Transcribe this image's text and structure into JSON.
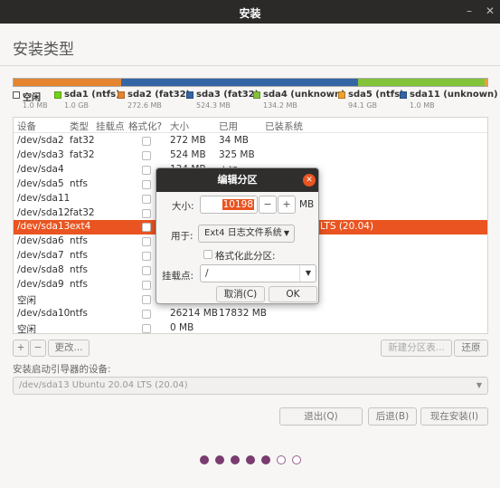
{
  "window": {
    "title": "安装",
    "minimize_glyph": "–",
    "close_glyph": "✕"
  },
  "page_heading": "安装类型",
  "partition_bar": {
    "segments": [
      {
        "name": "空闲",
        "fraction": 0.0003,
        "color": "#f0f0f0"
      },
      {
        "name": "sda1",
        "fraction": 0.0003,
        "color": "#73d216"
      },
      {
        "name": "sda2",
        "fraction": 0.227,
        "color": "#e5852f"
      },
      {
        "name": "sda3",
        "fraction": 0.499,
        "color": "#3465a4"
      },
      {
        "name": "sda4",
        "fraction": 0.267,
        "color": "#82c33a"
      },
      {
        "name": "sda5",
        "fraction": 0.006,
        "color": "#f0a030"
      },
      {
        "name": "sda11",
        "fraction": 0.0003,
        "color": "#3465a4"
      }
    ]
  },
  "legend": [
    {
      "name": "空闲",
      "size": "1.0 MB",
      "color": "#ffffff",
      "icon": "empty-square-icon"
    },
    {
      "name": "sda1 (ntfs)",
      "size": "1.0 GB",
      "color": "#73d216"
    },
    {
      "name": "sda2 (fat32)",
      "size": "272.6 MB",
      "color": "#e5852f"
    },
    {
      "name": "sda3 (fat32)",
      "size": "524.3 MB",
      "color": "#3465a4"
    },
    {
      "name": "sda4 (unknown)",
      "size": "134.2 MB",
      "color": "#82c33a"
    },
    {
      "name": "sda5 (ntfs)",
      "size": "94.1 GB",
      "color": "#f0a030"
    },
    {
      "name": "sda11 (unknown)",
      "size": "1.0 MB",
      "color": "#3465a4"
    }
  ],
  "table": {
    "headers": [
      "设备",
      "类型",
      "挂载点",
      "格式化?",
      "大小",
      "已用",
      "已装系统"
    ],
    "rows": [
      {
        "device": "/dev/sda2",
        "type": "fat32",
        "mount": "",
        "size": "272 MB",
        "used": "34 MB",
        "system": ""
      },
      {
        "device": "/dev/sda3",
        "type": "fat32",
        "mount": "",
        "size": "524 MB",
        "used": "325 MB",
        "system": ""
      },
      {
        "device": "/dev/sda4",
        "type": "",
        "mount": "",
        "size": "134 MB",
        "used": "未知",
        "system": ""
      },
      {
        "device": "/dev/sda5",
        "type": "ntfs",
        "mount": "",
        "size": "",
        "used": "",
        "system": ""
      },
      {
        "device": "/dev/sda11",
        "type": "",
        "mount": "",
        "size": "",
        "used": "",
        "system": ""
      },
      {
        "device": "/dev/sda12",
        "type": "fat32",
        "mount": "",
        "size": "",
        "used": "",
        "system": ""
      },
      {
        "device": "/dev/sda13",
        "type": "ext4",
        "mount": "",
        "size": "",
        "used": "",
        "system": "LTS (20.04)",
        "selected": true
      },
      {
        "device": "/dev/sda6",
        "type": "ntfs",
        "mount": "",
        "size": "",
        "used": "",
        "system": ""
      },
      {
        "device": "/dev/sda7",
        "type": "ntfs",
        "mount": "",
        "size": "",
        "used": "",
        "system": ""
      },
      {
        "device": "/dev/sda8",
        "type": "ntfs",
        "mount": "",
        "size": "",
        "used": "",
        "system": ""
      },
      {
        "device": "/dev/sda9",
        "type": "ntfs",
        "mount": "",
        "size": "",
        "used": "",
        "system": ""
      },
      {
        "device": "空闲",
        "type": "",
        "mount": "",
        "size": "",
        "used": "",
        "system": ""
      },
      {
        "device": "/dev/sda10",
        "type": "ntfs",
        "mount": "",
        "size": "26214 MB",
        "used": "17832 MB",
        "system": ""
      },
      {
        "device": "空闲",
        "type": "",
        "mount": "",
        "size": "0 MB",
        "used": "",
        "system": ""
      }
    ]
  },
  "table_tools": {
    "add": "+",
    "remove": "−",
    "change": "更改...",
    "new_table": "新建分区表...",
    "revert": "还原"
  },
  "boot_loader": {
    "label": "安装启动引导器的设备:",
    "value": "/dev/sda13 Ubuntu 20.04 LTS (20.04)",
    "arrow": "▼"
  },
  "actions": {
    "quit": "退出(Q)",
    "back": "后退(B)",
    "install": "现在安装(I)"
  },
  "progress": {
    "total_steps": 7,
    "current_step": 5
  },
  "dialog": {
    "title": "编辑分区",
    "close_glyph": "✕",
    "size_label": "大小:",
    "size_value": "10198",
    "minus": "−",
    "plus": "+",
    "size_unit": "MB",
    "use_as_label": "用于:",
    "use_as_value": "Ext4 日志文件系统",
    "format_label": "格式化此分区:",
    "format_checked": false,
    "mount_label": "挂载点:",
    "mount_value": "/",
    "cancel": "取消(C)",
    "ok": "OK"
  }
}
